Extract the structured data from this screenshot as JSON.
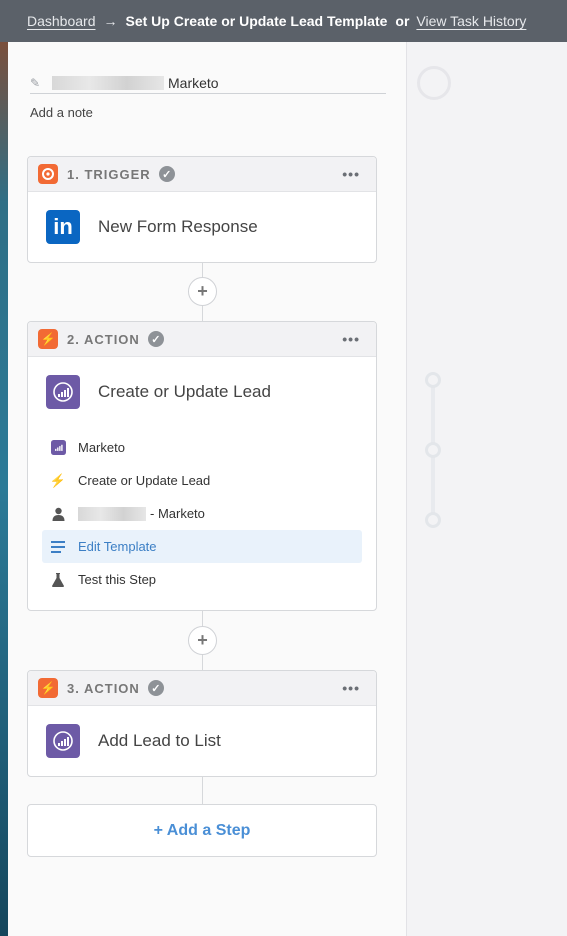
{
  "breadcrumb": {
    "dashboard_label": "Dashboard",
    "arrow": "→",
    "current_label": "Set Up Create or Update Lead Template",
    "or_label": "or",
    "history_label": "View Task History"
  },
  "zap": {
    "name_suffix": "Marketo",
    "add_note_label": "Add a note"
  },
  "steps": [
    {
      "header": "1. TRIGGER",
      "badge_icon": "orange-target-icon",
      "app_title": "New Form Response",
      "app_icon": "linkedin-icon"
    },
    {
      "header": "2. ACTION",
      "badge_icon": "lightning-icon",
      "app_title": "Create or Update Lead",
      "app_icon": "marketo-icon",
      "details": [
        {
          "icon": "marketo-icon",
          "label": "Marketo"
        },
        {
          "icon": "lightning-icon",
          "label": "Create or Update Lead"
        },
        {
          "icon": "person-icon",
          "label": "- Marketo"
        },
        {
          "icon": "list-icon",
          "label": "Edit Template"
        },
        {
          "icon": "flask-icon",
          "label": "Test this Step"
        }
      ]
    },
    {
      "header": "3. ACTION",
      "badge_icon": "lightning-icon",
      "app_title": "Add Lead to List",
      "app_icon": "marketo-icon"
    }
  ],
  "add_step_label": "+ Add a Step",
  "colors": {
    "topbar": "#5b6169",
    "accent_orange": "#f26a34",
    "link_blue": "#4a8fd6",
    "active_bg": "#e9f2fb",
    "marketo_purple": "#6d5aa6",
    "linkedin_blue": "#0a66c2"
  }
}
